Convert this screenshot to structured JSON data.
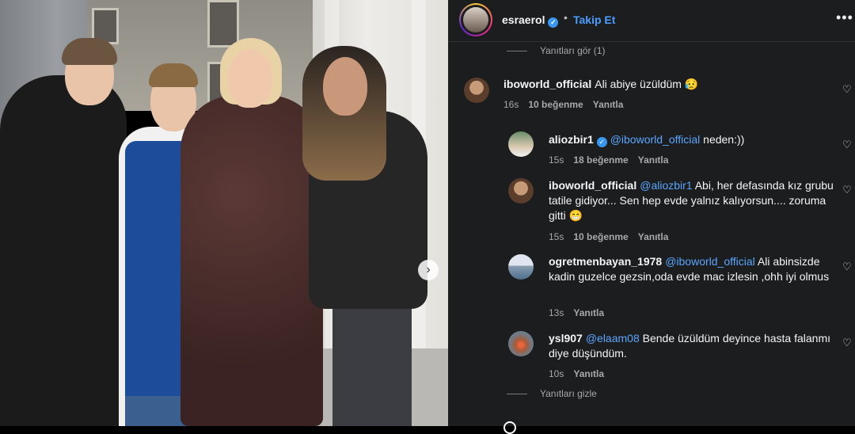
{
  "post": {
    "author": "esraerol",
    "follow_label": "Takip Et",
    "separator": "•",
    "more_icon": "ellipsis-icon"
  },
  "replies_toggle": {
    "show_label": "Yanıtları gör (1)",
    "hide_label": "Yanıtları gizle"
  },
  "comments": [
    {
      "user": "iboworld_official",
      "text": "Ali abiye üzüldüm 😥",
      "mention": "",
      "time": "16s",
      "likes": "10 beğenme",
      "reply": "Yanıtla"
    },
    {
      "user": "aliozbir1",
      "verified": true,
      "mention": "@iboworld_official",
      "text": " neden:))",
      "time": "15s",
      "likes": "18 beğenme",
      "reply": "Yanıtla"
    },
    {
      "user": "iboworld_official",
      "mention": "@aliozbir1",
      "text": " Abi, her defasında kız grubu tatile gidiyor... Sen hep evde yalnız kalıyorsun.... zoruma gitti 😁",
      "time": "15s",
      "likes": "10 beğenme",
      "reply": "Yanıtla"
    },
    {
      "user": "ogretmenbayan_1978",
      "mention": "@iboworld_official",
      "text": " Ali abinsizde kadin guzelce gezsin,oda evde mac izlesin ,ohh iyi olmus",
      "time": "13s",
      "likes": "",
      "reply": "Yanıtla"
    },
    {
      "user": "ysl907",
      "mention": "@elaam08",
      "text": " Bende üzüldüm deyince hasta falanmı diye düşündüm.",
      "time": "10s",
      "likes": "",
      "reply": "Yanıtla"
    }
  ],
  "colors": {
    "panel_bg": "#1c1d1f",
    "link": "#4a9dff",
    "mention": "#5aa6ff",
    "verified": "#3897f0"
  }
}
